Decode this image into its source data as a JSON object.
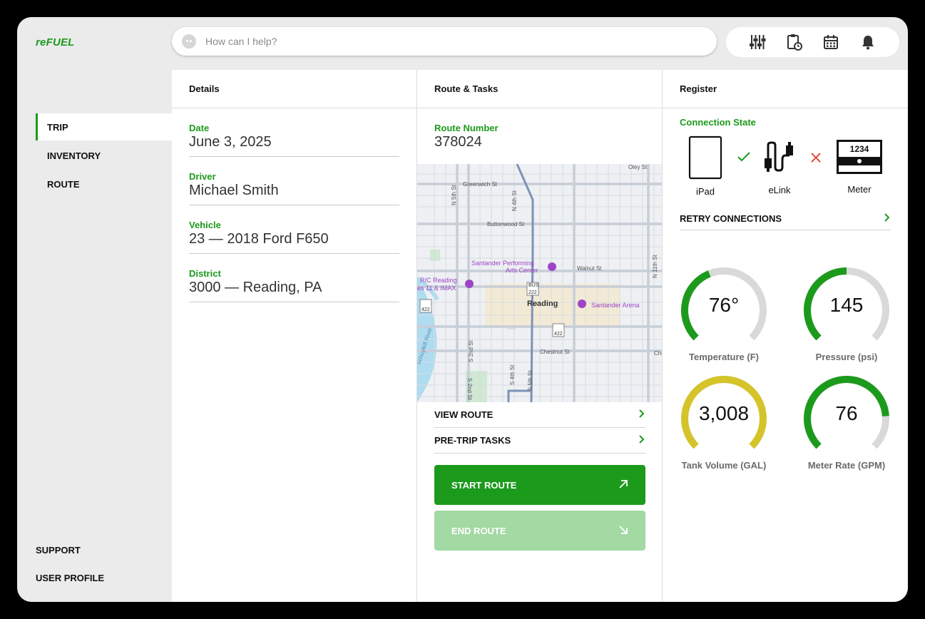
{
  "app": {
    "logo": "reFUEL"
  },
  "search": {
    "placeholder": "How can I help?"
  },
  "toolbar": {
    "icons": [
      "sliders-icon",
      "clipboard-clock-icon",
      "calendar-icon",
      "bell-icon"
    ]
  },
  "sidebar": {
    "items": [
      {
        "label": "TRIP",
        "active": true
      },
      {
        "label": "INVENTORY",
        "active": false
      },
      {
        "label": "ROUTE",
        "active": false
      }
    ],
    "footer": [
      {
        "label": "SUPPORT"
      },
      {
        "label": "USER PROFILE"
      }
    ]
  },
  "details": {
    "title": "Details",
    "fields": [
      {
        "label": "Date",
        "value": "June 3, 2025"
      },
      {
        "label": "Driver",
        "value": "Michael Smith"
      },
      {
        "label": "Vehicle",
        "value": "23 — 2018 Ford F650"
      },
      {
        "label": "District",
        "value": "3000 — Reading, PA"
      }
    ]
  },
  "route": {
    "title": "Route & Tasks",
    "number_label": "Route Number",
    "number": "378024",
    "map_labels": {
      "greenwich": "Greenwich St",
      "oley": "Oley St",
      "buttonwood": "Buttonwood St",
      "walnut": "Walnut St",
      "chestnut": "Chestnut St",
      "n4th": "N 4th St",
      "n5th": "N 5th St",
      "n11th": "N 11th St",
      "s2nd": "S 2nd St",
      "s4th": "S 4th St",
      "s5th": "S 5th St",
      "schuylkill": "Schuylkill River",
      "santander_pac_1": "Santander Performing",
      "santander_pac_2": "Arts Center",
      "rc_1": "R/C Reading",
      "rc_2": "es 11 & IMAX",
      "reading": "Reading",
      "santander_arena": "Santander Arena",
      "cross": "Che",
      "r222": "222",
      "r422a": "422",
      "r422b": "422",
      "bus": "BUS"
    },
    "links": [
      {
        "label": "VIEW ROUTE"
      },
      {
        "label": "PRE-TRIP TASKS"
      }
    ],
    "start_label": "START ROUTE",
    "end_label": "END ROUTE"
  },
  "register": {
    "title": "Register",
    "connection_label": "Connection State",
    "devices": [
      {
        "label": "iPad",
        "icon": "tablet-icon"
      },
      {
        "label": "eLink",
        "icon": "cable-icon"
      },
      {
        "label": "Meter",
        "icon": "meter-icon",
        "reading": "1234"
      }
    ],
    "status": [
      {
        "between": "iPad-eLink",
        "state": "connected",
        "color": "#1c9a1c"
      },
      {
        "between": "eLink-Meter",
        "state": "disconnected",
        "color": "#e04a3a"
      }
    ],
    "retry_label": "RETRY CONNECTIONS",
    "gauges": [
      {
        "value": "76°",
        "label": "Temperature (F)",
        "fraction": 0.42,
        "color": "#1c9a1c"
      },
      {
        "value": "145",
        "label": "Pressure (psi)",
        "fraction": 0.5,
        "color": "#1c9a1c"
      },
      {
        "value": "3,008",
        "label": "Tank Volume (GAL)",
        "fraction": 1.0,
        "color": "#d4c42a"
      },
      {
        "value": "76",
        "label": "Meter Rate (GPM)",
        "fraction": 0.82,
        "color": "#1c9a1c"
      }
    ],
    "gauge_track_color": "#d9d9d9"
  }
}
